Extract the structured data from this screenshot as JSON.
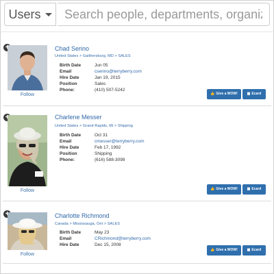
{
  "header": {
    "scope_label": "Users",
    "search_placeholder": "Search people, departments, organizations"
  },
  "people": [
    {
      "name": "Chad Serino",
      "breadcrumb": "United States > Gaithersburg, MD > SALES",
      "fields": [
        {
          "label": "Birth Date",
          "value": "Jun 05"
        },
        {
          "label": "Email",
          "value": "cserino@terryberry.com"
        },
        {
          "label": "Hire Date",
          "value": "Jan 19, 2015"
        },
        {
          "label": "Position",
          "value": "Sales"
        },
        {
          "label": "Phone:",
          "value": "(410) 507-5242"
        }
      ],
      "follow_label": "Follow",
      "wow_label": "Give a WOW!",
      "ecard_label": "Ecard"
    },
    {
      "name": "Charlene Messer",
      "breadcrumb": "United States > Grand Rapids, Mi > Shipping",
      "fields": [
        {
          "label": "Birth Date",
          "value": "Oct 31"
        },
        {
          "label": "Email",
          "value": "cmesser@terryberry.com"
        },
        {
          "label": "Hire Date",
          "value": "Feb 17, 1992"
        },
        {
          "label": "Position",
          "value": "Shipping"
        },
        {
          "label": "Phone:",
          "value": "(616) 588-3098"
        }
      ],
      "follow_label": "Follow",
      "wow_label": "Give a WOW!",
      "ecard_label": "Ecard"
    },
    {
      "name": "Charlotte Richmond",
      "breadcrumb": "Canada > Mississauga, Ont > SALES",
      "fields": [
        {
          "label": "Birth Date",
          "value": "May 23"
        },
        {
          "label": "Email",
          "value": "CRichmond@terryberry.com"
        },
        {
          "label": "Hire Date",
          "value": "Dec 15, 2008"
        }
      ],
      "follow_label": "Follow",
      "wow_label": "Give a WOW!",
      "ecard_label": "Ecard"
    }
  ],
  "colors": {
    "link": "#2f67a8",
    "button": "#2f6fad"
  }
}
